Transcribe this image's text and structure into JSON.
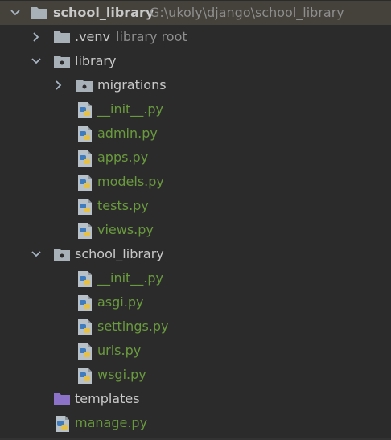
{
  "project": {
    "name": "school_library",
    "path": "G:\\ukoly\\django\\school_library"
  },
  "venv": {
    "name": ".venv",
    "hint": "library root"
  },
  "library": {
    "name": "library",
    "migrations": "migrations",
    "files": [
      "__init__.py",
      "admin.py",
      "apps.py",
      "models.py",
      "tests.py",
      "views.py"
    ]
  },
  "school_library_pkg": {
    "name": "school_library",
    "files": [
      "__init__.py",
      "asgi.py",
      "settings.py",
      "urls.py",
      "wsgi.py"
    ]
  },
  "templates": "templates",
  "manage": "manage.py",
  "colors": {
    "background": "#2b2b2b",
    "selected_row": "#45413b",
    "text": "#c9c9c9",
    "file_text_green": "#6a9a3e",
    "hint_text": "#8e8e8e",
    "folder_gray": "#a9b1b8",
    "folder_purple": "#8c73c9"
  }
}
